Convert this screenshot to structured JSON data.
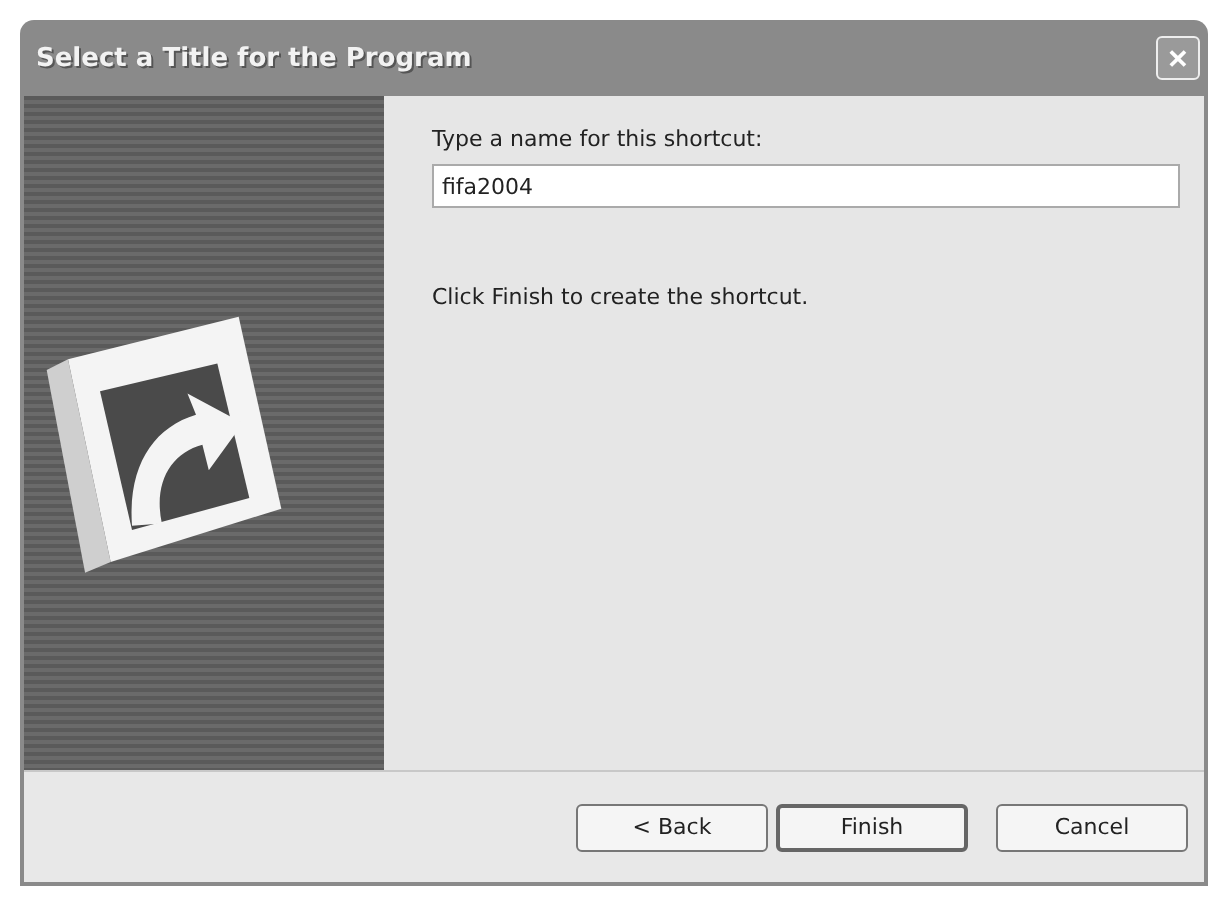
{
  "window": {
    "title": "Select a Title for the Program",
    "close": "✕"
  },
  "prompt": "Type a name for this shortcut:",
  "name_field": {
    "value": "fifa2004"
  },
  "instruction": "Click Finish to create the shortcut.",
  "buttons": [
    {
      "label": "< Back",
      "default": false
    },
    {
      "label": "Finish",
      "default": true
    },
    {
      "label": "Cancel",
      "default": false
    }
  ]
}
